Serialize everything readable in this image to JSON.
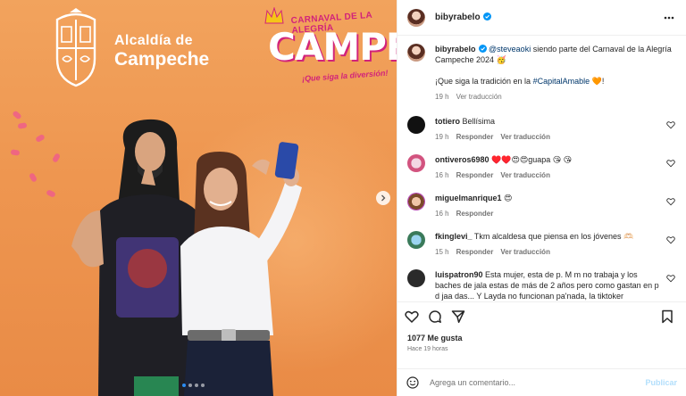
{
  "media": {
    "alcaldia_line1": "Alcaldía de",
    "alcaldia_line2": "Campeche",
    "carnaval_top": "CARNAVAL DE LA ALEGRÍA",
    "carnaval_big": "CAMPECHE",
    "carnaval_sub": "¡Que siga la diversión!",
    "current_slide": 1,
    "slide_count": 4
  },
  "header": {
    "username": "bibyrabelo",
    "verified": true,
    "more_icon": "more-horizontal-icon"
  },
  "caption": {
    "username": "bibyrabelo",
    "mention": "@steveaoki",
    "text_1": " siendo parte del Carnaval de la Alegría Campeche 2024 🥳",
    "text_2": "¡Que siga la tradición en la ",
    "hashtag": "#CapitalAmable",
    "text_3": " 🧡!",
    "time": "19 h",
    "translate": "Ver traducción"
  },
  "comments": [
    {
      "username": "totiero",
      "text": "Bellísima",
      "time": "19 h",
      "reply": "Responder",
      "translate": "Ver traducción"
    },
    {
      "username": "ontiveros6980",
      "text": "♥️♥️😍😍guapa 😘 😘",
      "time": "16 h",
      "reply": "Responder",
      "translate": "Ver traducción"
    },
    {
      "username": "miguelmanrique1",
      "text": "😍",
      "time": "16 h",
      "reply": "Responder",
      "translate": ""
    },
    {
      "username": "fkinglevi_",
      "text": "Tkm alcaldesa que piensa en los jóvenes 🫶🏻",
      "time": "15 h",
      "reply": "Responder",
      "translate": "Ver traducción"
    },
    {
      "username": "luispatron90",
      "text": "Esta mujer, esta de p. M m no trabaja y los baches de jala estas de más de 2 años pero como gastan en p d jaa das... Y Layda no funcionan pa'nada, la tiktoker",
      "time": "",
      "reply": "",
      "translate": ""
    }
  ],
  "actions": {
    "like_icon": "heart-icon",
    "comment_icon": "comment-icon",
    "share_icon": "share-icon",
    "save_icon": "bookmark-icon"
  },
  "likes": "1077 Me gusta",
  "posted_ago": "Hace 19 horas",
  "composer": {
    "placeholder": "Agrega un comentario...",
    "publish": "Publicar",
    "emoji_icon": "emoji-icon"
  },
  "colors": {
    "accent": "#0095f6",
    "link": "#00376b",
    "muted": "#737373",
    "media_bg": "#ee9650",
    "carnaval_pink": "#d2237a"
  }
}
